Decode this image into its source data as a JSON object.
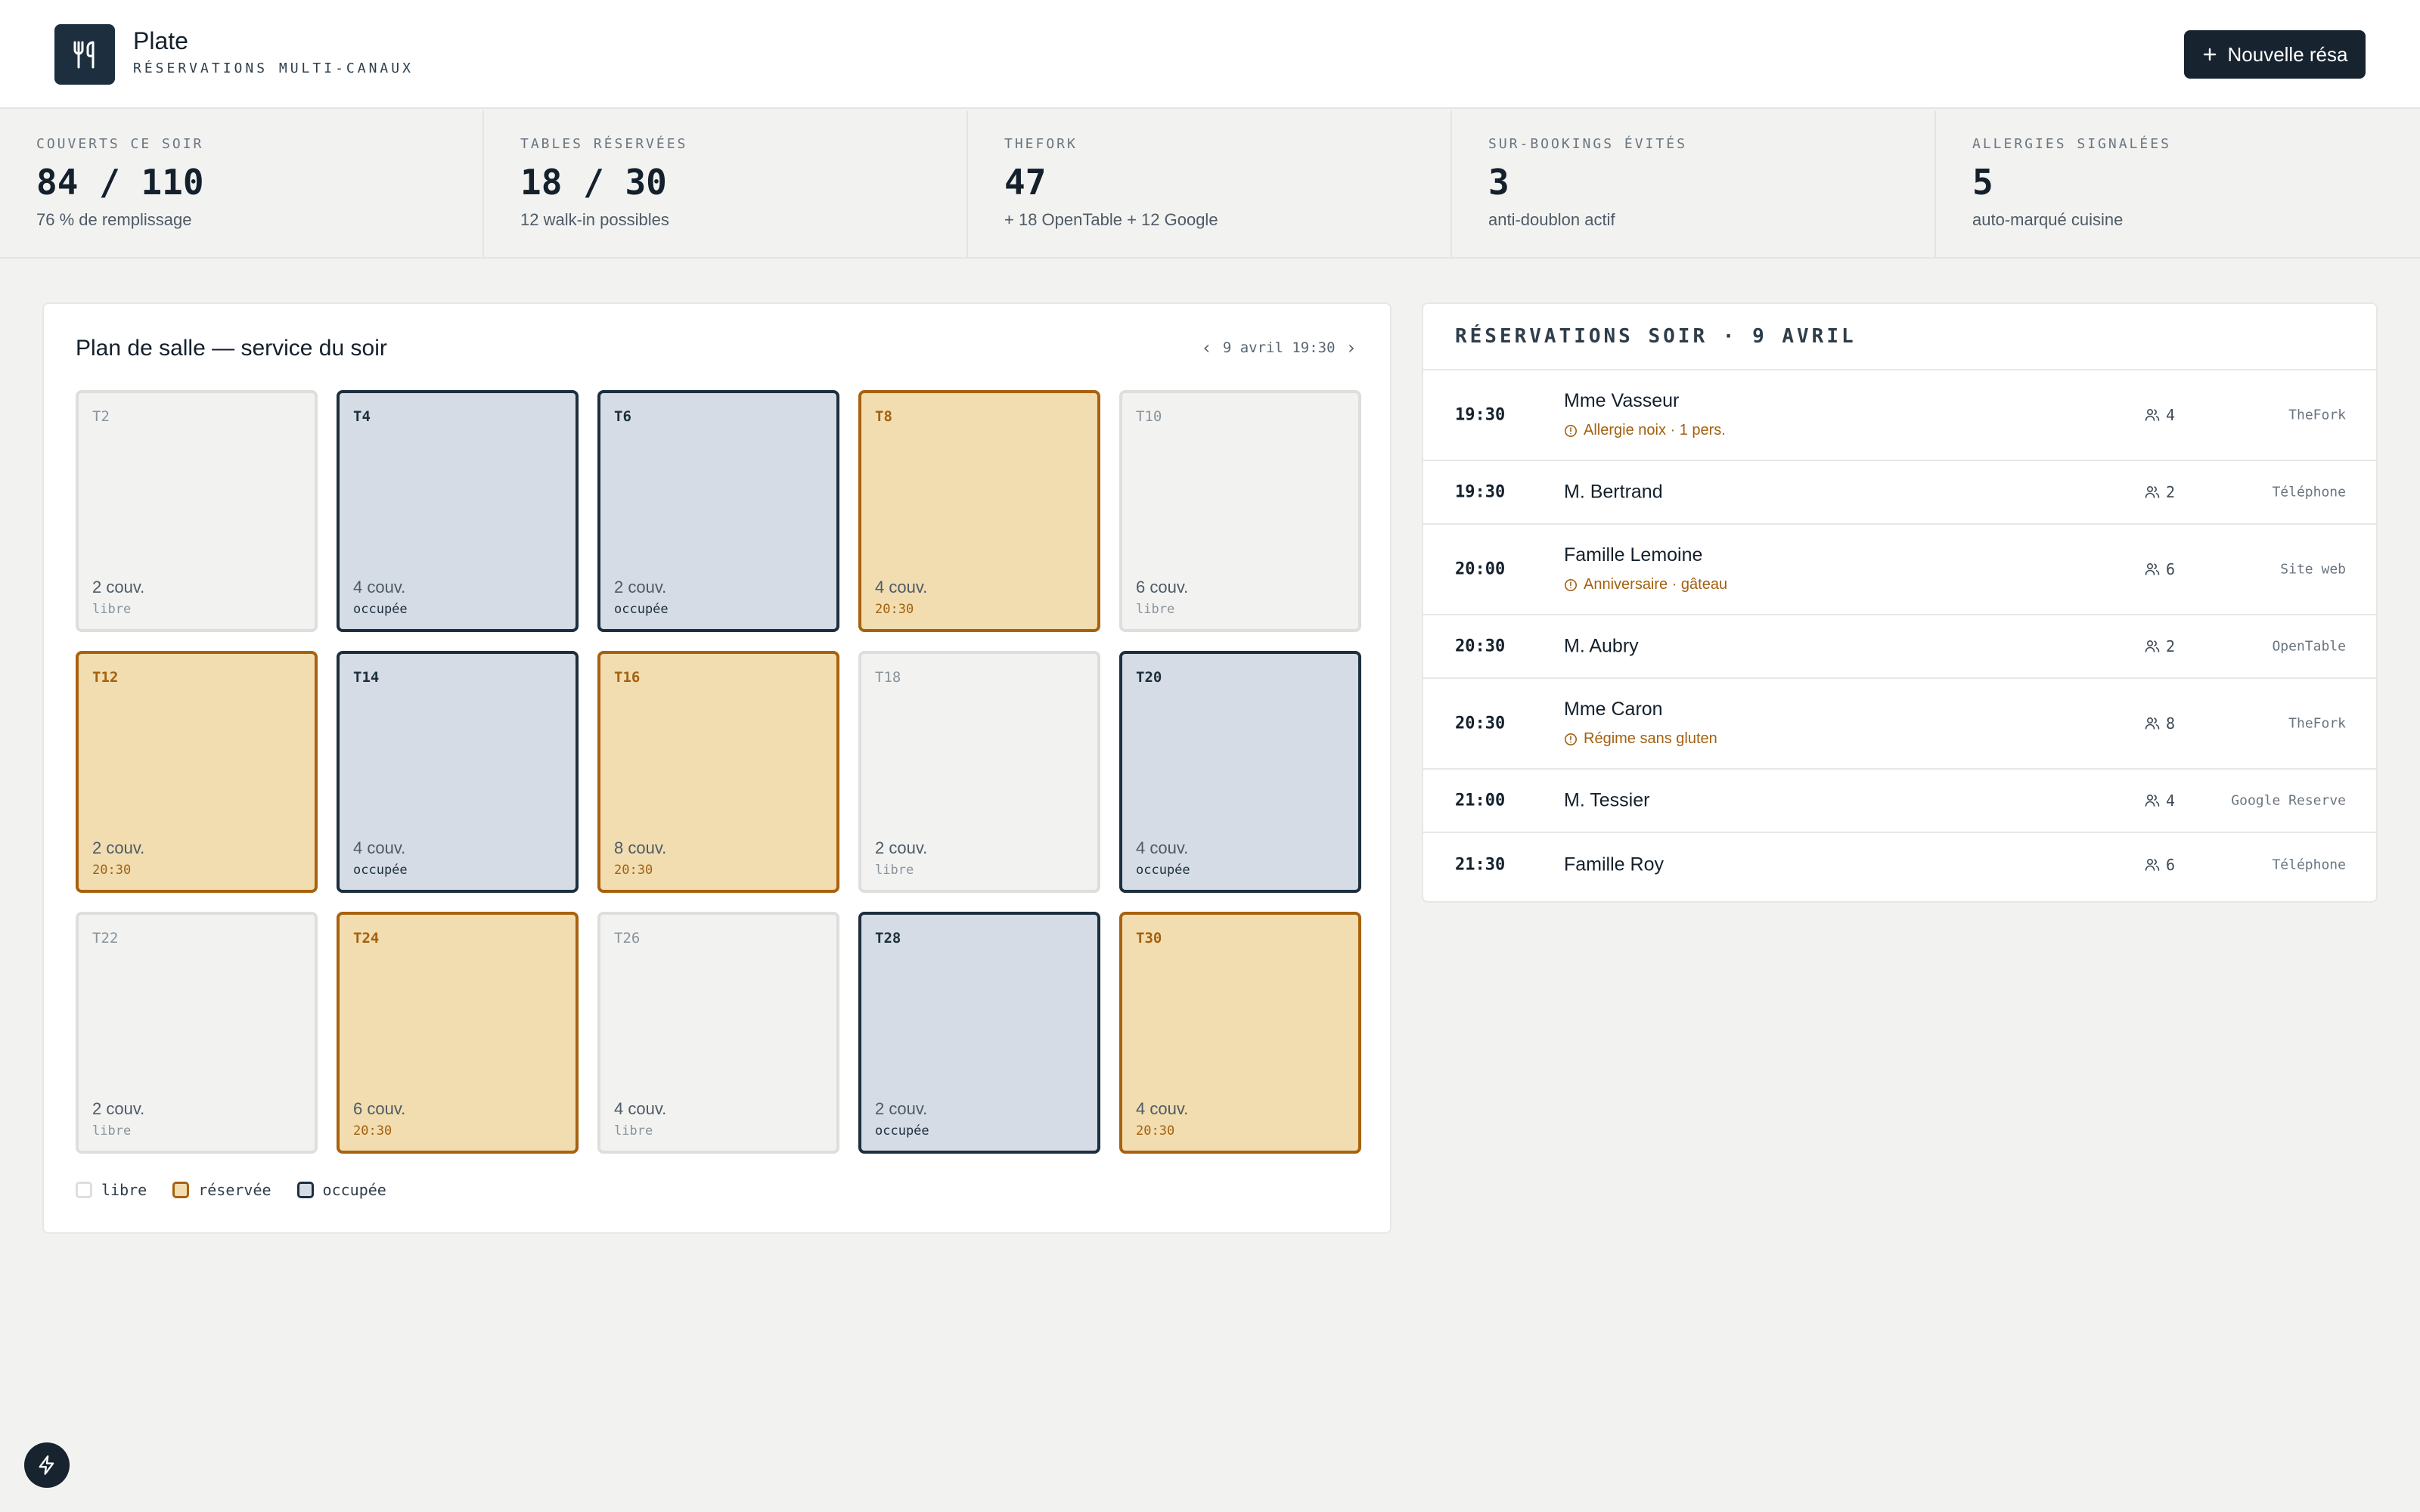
{
  "header": {
    "brand_name": "Plate",
    "brand_subtitle": "RÉSERVATIONS MULTI-CANAUX",
    "new_button_label": "Nouvelle résa",
    "logo_icon": "utensils-icon"
  },
  "stats": [
    {
      "label": "COUVERTS CE SOIR",
      "value": "84 / 110",
      "note": "76 % de remplissage"
    },
    {
      "label": "TABLES RÉSERVÉES",
      "value": "18 / 30",
      "note": "12 walk-in possibles"
    },
    {
      "label": "THEFORK",
      "value": "47",
      "note": "+ 18 OpenTable + 12 Google"
    },
    {
      "label": "SUR-BOOKINGS ÉVITÉS",
      "value": "3",
      "note": "anti-doublon actif"
    },
    {
      "label": "ALLERGIES SIGNALÉES",
      "value": "5",
      "note": "auto-marqué cuisine"
    }
  ],
  "floor_plan": {
    "title": "Plan de salle — service du soir",
    "datetime": "9 avril 19:30",
    "tables": [
      {
        "name": "T2",
        "covers": "2 couv.",
        "status": "libre",
        "state": "libre"
      },
      {
        "name": "T4",
        "covers": "4 couv.",
        "status": "occupée",
        "state": "occupee"
      },
      {
        "name": "T6",
        "covers": "2 couv.",
        "status": "occupée",
        "state": "occupee"
      },
      {
        "name": "T8",
        "covers": "4 couv.",
        "status": "20:30",
        "state": "reservee"
      },
      {
        "name": "T10",
        "covers": "6 couv.",
        "status": "libre",
        "state": "libre"
      },
      {
        "name": "T12",
        "covers": "2 couv.",
        "status": "20:30",
        "state": "reservee"
      },
      {
        "name": "T14",
        "covers": "4 couv.",
        "status": "occupée",
        "state": "occupee"
      },
      {
        "name": "T16",
        "covers": "8 couv.",
        "status": "20:30",
        "state": "reservee"
      },
      {
        "name": "T18",
        "covers": "2 couv.",
        "status": "libre",
        "state": "libre"
      },
      {
        "name": "T20",
        "covers": "4 couv.",
        "status": "occupée",
        "state": "occupee"
      },
      {
        "name": "T22",
        "covers": "2 couv.",
        "status": "libre",
        "state": "libre"
      },
      {
        "name": "T24",
        "covers": "6 couv.",
        "status": "20:30",
        "state": "reservee"
      },
      {
        "name": "T26",
        "covers": "4 couv.",
        "status": "libre",
        "state": "libre"
      },
      {
        "name": "T28",
        "covers": "2 couv.",
        "status": "occupée",
        "state": "occupee"
      },
      {
        "name": "T30",
        "covers": "4 couv.",
        "status": "20:30",
        "state": "reservee"
      }
    ],
    "legend": {
      "libre": "libre",
      "reservee": "réservée",
      "occupee": "occupée"
    }
  },
  "reservations": {
    "title": "RÉSERVATIONS SOIR · 9 AVRIL",
    "rows": [
      {
        "time": "19:30",
        "name": "Mme Vasseur",
        "note": "Allergie noix · 1 pers.",
        "party": "4",
        "source": "TheFork"
      },
      {
        "time": "19:30",
        "name": "M. Bertrand",
        "note": "",
        "party": "2",
        "source": "Téléphone"
      },
      {
        "time": "20:00",
        "name": "Famille Lemoine",
        "note": "Anniversaire · gâteau",
        "party": "6",
        "source": "Site web"
      },
      {
        "time": "20:30",
        "name": "M. Aubry",
        "note": "",
        "party": "2",
        "source": "OpenTable"
      },
      {
        "time": "20:30",
        "name": "Mme Caron",
        "note": "Régime sans gluten",
        "party": "8",
        "source": "TheFork"
      },
      {
        "time": "21:00",
        "name": "M. Tessier",
        "note": "",
        "party": "4",
        "source": "Google Reserve"
      },
      {
        "time": "21:30",
        "name": "Famille Roy",
        "note": "",
        "party": "6",
        "source": "Téléphone"
      }
    ]
  },
  "colors": {
    "brand_dark": "#1d2f3e",
    "reserved_border": "#a8620f",
    "reserved_fill": "#f1ddb0",
    "occupied_fill": "#d5dce5",
    "free_fill": "#f2f3f1"
  }
}
